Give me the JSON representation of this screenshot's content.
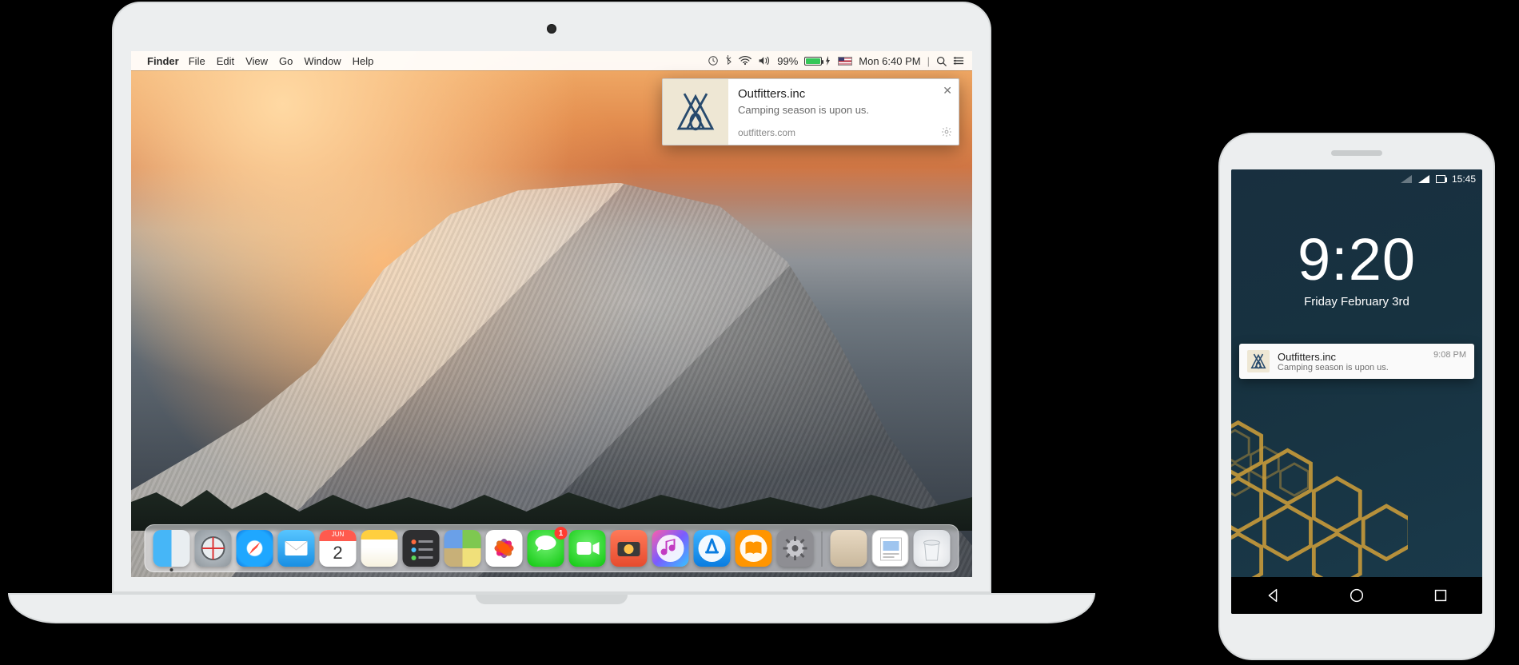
{
  "mac": {
    "menubar": {
      "app_name": "Finder",
      "menus": [
        "File",
        "Edit",
        "View",
        "Go",
        "Window",
        "Help"
      ],
      "battery_pct": "99%",
      "clock": "Mon 6:40 PM",
      "divider": "|"
    },
    "notification": {
      "title": "Outfitters.inc",
      "message": "Camping season is upon us.",
      "site": "outfitters.com"
    },
    "dock": {
      "cal_month": "JUN",
      "cal_day": "2",
      "msg_badge": "1"
    }
  },
  "phone": {
    "status_time": "15:45",
    "lock_time": "9:20",
    "lock_date": "Friday February 3rd",
    "notification": {
      "title": "Outfitters.inc",
      "message": "Camping season is upon us.",
      "when": "9:08 PM"
    }
  }
}
